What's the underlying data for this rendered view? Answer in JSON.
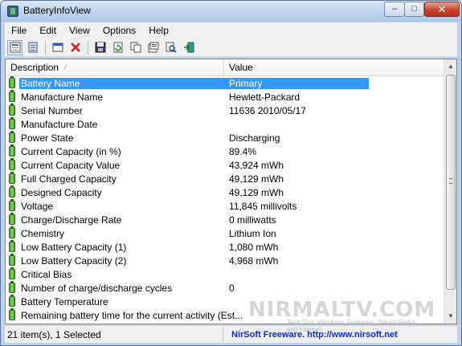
{
  "window": {
    "title": "BatteryInfoView",
    "controls": {
      "minimize": "–",
      "maximize": "□",
      "close": "✕"
    }
  },
  "menu": [
    "File",
    "Edit",
    "View",
    "Options",
    "Help"
  ],
  "toolbar": {
    "icons": [
      "html-report-icon",
      "properties-icon",
      "export-icon",
      "delete-icon",
      "save-icon",
      "refresh-icon",
      "copy-icon",
      "options-icon",
      "find-icon",
      "exit-icon"
    ]
  },
  "list": {
    "columns": {
      "description": "Description",
      "value": "Value",
      "sort_arrow": "⁄"
    },
    "rows": [
      {
        "label": "Battery Name",
        "value": "Primary",
        "selected": true
      },
      {
        "label": "Manufacture Name",
        "value": "Hewlett-Packard"
      },
      {
        "label": "Serial Number",
        "value": "11636 2010/05/17"
      },
      {
        "label": "Manufacture Date",
        "value": ""
      },
      {
        "label": "Power State",
        "value": "Discharging"
      },
      {
        "label": "Current Capacity (in %)",
        "value": "89.4%"
      },
      {
        "label": "Current Capacity Value",
        "value": "43,924 mWh"
      },
      {
        "label": "Full Charged Capacity",
        "value": "49,129 mWh"
      },
      {
        "label": "Designed Capacity",
        "value": "49,129 mWh"
      },
      {
        "label": "Voltage",
        "value": "11,845 millivolts"
      },
      {
        "label": "Charge/Discharge Rate",
        "value": "0 milliwatts"
      },
      {
        "label": "Chemistry",
        "value": "Lithium Ion"
      },
      {
        "label": "Low Battery Capacity (1)",
        "value": "1,080 mWh"
      },
      {
        "label": "Low Battery Capacity (2)",
        "value": "4,968 mWh"
      },
      {
        "label": "Critical Bias",
        "value": ""
      },
      {
        "label": "Number of charge/discharge cycles",
        "value": "0"
      },
      {
        "label": "Battery Temperature",
        "value": ""
      },
      {
        "label": "Remaining battery time for the current activity (Est...",
        "value": ""
      }
    ]
  },
  "status": {
    "items": "21 item(s), 1 Selected",
    "credit": "NirSoft Freeware.  http://www.nirsoft.net"
  },
  "watermark": {
    "brand": "NIRMALTV.COM",
    "tagline": "Tech Tips, Windows, Freeware, Social Media and Internet"
  },
  "colors": {
    "selection": "#3399ff",
    "credit_link": "#0a2dc8",
    "battery_green": "#3f9a2a"
  }
}
